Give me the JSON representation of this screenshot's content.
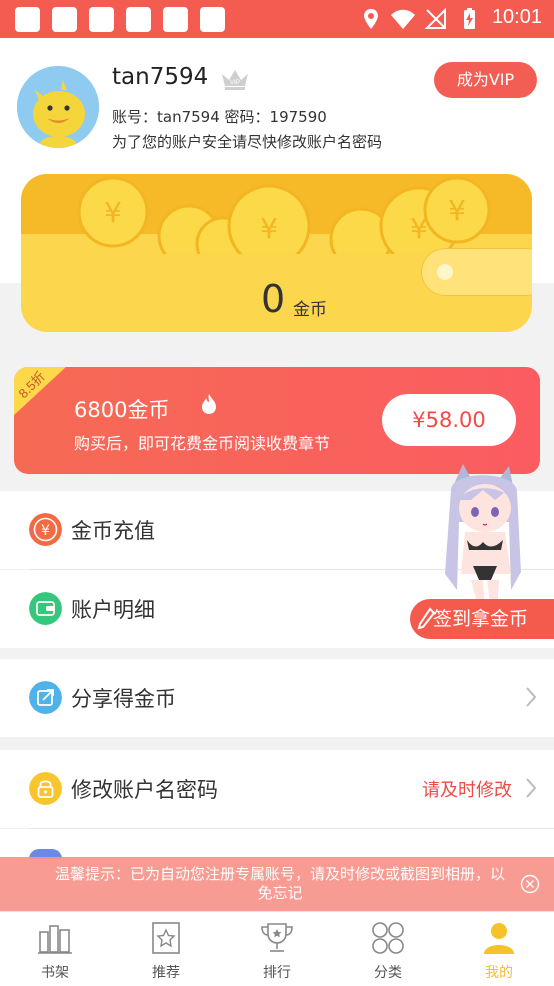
{
  "status_bar": {
    "time": "10:01"
  },
  "profile": {
    "username": "tan7594",
    "account_line": "账号：tan7594 密码：197590",
    "warning": "为了您的账户安全请尽快修改账户名密码",
    "vip_button": "成为VIP",
    "crown_badge": "VIP"
  },
  "gold": {
    "amount": "0",
    "unit": "金币"
  },
  "promo": {
    "badge": "8.5折",
    "title": "6800金币",
    "subtitle": "购买后，即可花费金币阅读收费章节",
    "price": "¥58.00"
  },
  "menu": {
    "recharge": "金币充值",
    "details": "账户明细",
    "share": "分享得金币",
    "modify": "修改账户名密码",
    "modify_hint": "请及时修改"
  },
  "sign_button": "签到拿金币",
  "toast": {
    "text": "温馨提示：已为自动您注册专属账号，请及时修改或截图到相册，以免忘记"
  },
  "nav": {
    "items": [
      {
        "label": "书架",
        "icon": "bookshelf-icon"
      },
      {
        "label": "推荐",
        "icon": "recommend-icon"
      },
      {
        "label": "排行",
        "icon": "ranking-icon"
      },
      {
        "label": "分类",
        "icon": "category-icon"
      },
      {
        "label": "我的",
        "icon": "profile-icon"
      }
    ],
    "active_index": 4
  },
  "colors": {
    "accent": "#f45c52",
    "gold": "#fcd64d",
    "active_tab": "#f6c22a"
  }
}
